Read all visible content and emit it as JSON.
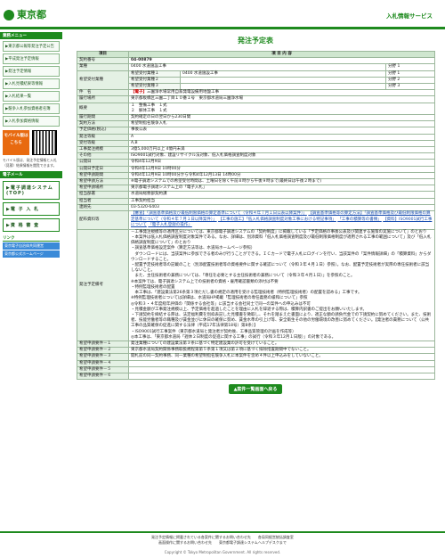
{
  "header": {
    "logo": "東京都",
    "site_name": "入札情報サービス"
  },
  "sidebar": {
    "menu_head": "業務メニュー",
    "items": [
      {
        "label": "▶東京都公報等発注予定公告"
      },
      {
        "label": "▶平成発注予定情報"
      },
      {
        "label": "▶発注予定情報"
      },
      {
        "label": "▶入札見積結果等情報"
      },
      {
        "label": "▶入札結果一覧"
      },
      {
        "label": "▶競争入札参加資格者名簿"
      },
      {
        "label": "▶入札参加資格情報"
      }
    ],
    "mobile_label": "モバイル版はこちら",
    "mobile_note": "モバイル版は、発注予定情報と入札（見積）結果情報を閲覧できます。",
    "big_head": "電子メール",
    "big_buttons": [
      {
        "label": "▶電子調達システム(TOP)"
      },
      {
        "label": "▶電 子 入 札"
      },
      {
        "label": "▶資 格 審 査"
      }
    ],
    "link_head": "リンク",
    "links": [
      {
        "label": "東京電子自治体共同運営"
      },
      {
        "label": "東京都公式ホームページ"
      }
    ]
  },
  "page_title": "発注予定表",
  "table_header": {
    "item": "項目",
    "content": "項 目 内 容"
  },
  "rows": {
    "contract_no": {
      "label": "契約番号",
      "value": "04-00879"
    },
    "business": {
      "label": "業種",
      "value": "0400 水道施設工事",
      "bun_label": "分野",
      "bun": "1"
    },
    "kibo": {
      "label": "希望受付業種",
      "r1": "希望受付業種１",
      "r1v": "0400 水道施設工事",
      "r2": "希望受付業種２",
      "r3": "希望受付業種３",
      "b1": "分野 1",
      "b2": "分野 2",
      "b3": "分野 3"
    },
    "name": {
      "label": "件　名",
      "tag": "【電子】",
      "value": "三園浄水場常用自家発電設備用地盤工事"
    },
    "place": {
      "label": "履行場所",
      "value": "東京都板橋区三園二丁目１０番１号　東京都水道局三園浄水場"
    },
    "outline": {
      "label": "概要",
      "l1": "１　整備工事　１式",
      "l2": "２　解体工事　１式"
    },
    "period": {
      "label": "履行期間",
      "value": "契約確定の日の翌日から230日間"
    },
    "method": {
      "label": "契約方法",
      "value": "希望制指名競争入札"
    },
    "price": {
      "label": "予定価格(税込)",
      "value": "事後公表"
    },
    "dept": {
      "label": "発注等級",
      "value": "A"
    },
    "grade": {
      "label": "受付等級",
      "value": "A,B"
    },
    "scale": {
      "label": "工事発注規模",
      "value": "3億5,000万円以上 4億円未満"
    },
    "other": {
      "label": "その他",
      "value": "ISO9001試行対象、建設リサイクル法対象、低入札価格調査制度対象"
    },
    "announce": {
      "label": "公開日",
      "value": "令和4年12月9日"
    },
    "koukai": {
      "label": "公開日予定日",
      "value": "令和4年12月9日 10時00分"
    },
    "kiboper": {
      "label": "希望申請期間",
      "value": "令和4年12月9日 10時00分から令和4年12月13日 14時00分"
    },
    "howto": {
      "label": "希望申請方法",
      "value": "※電子調達システムでの希望受付時間は、土曜日を除く午前８時から午後９時まで(最終日は午後２時まで)"
    },
    "where": {
      "label": "希望申請場所",
      "value": "東京都電子調達システム上の「電子入札」"
    },
    "office": {
      "label": "担当部署",
      "value": "水道局総務部契約課"
    },
    "person": {
      "label": "担当者",
      "value": "工事契約担当"
    },
    "tel": {
      "label": "連絡先",
      "value": "03-5320-6403"
    },
    "docs": {
      "label": "配布資料等",
      "l1": "【審査】「調査基準価格及び最低制限価格の算定基準について（令和４年７月１日公表以降案件）」",
      "l2": "【調査基準価格等の算定方法】「調査基準価格及び最低制限価格の算定基準について（令和４年７月１日以降案件）」",
      "l3": "【工事の施工】「低入札価格調査制度対象工事における特記事項」",
      "l4": "「工事の積算等の書類」",
      "l5": "【資料】ISO9001試行工事について",
      "l6": "『電子入札登録の操作』"
    },
    "memo": {
      "label": "発注予定備考",
      "lines": [
        "－工事発注規模等の適用区分については、東京都電子調達システムの「契約制度」に掲載している「予定価格の事後公表及び関連する施策の実施について」のとおり",
        "・本案件は低入札価格調査制度対象案件である。なお、詳細は、別添資料「低入札価格調査制度及び最低制限価格制度が適用される工事の範囲について」及び「低入札価格調査制度について」のとおり",
        "・調査基準価格設定案件（算定方法等は、水道局ホームページ参照）",
        "　ダウンロードには、当該案件に参加できる者のみが行うことができる。ＩＣカードで電子入札にログインを行い、当該案件の「案件情報詳細」の「積算資料」からダウンロードすること。",
        "・配置予定技術者等の記載のこと（別添配置技術者等の資格要件に関する確認について（令和３年４月１日）参照）。なお、配置予定技術者が実際の専任技術者に該当しないこと。",
        "　また、主任技術者の兼務については、「専任を必要とする主任技術者の兼務について（令和３年４月１日）」を参照のこと。",
        "※本案件では、電子調達システム上での技術者の資格・雇用確認書類の添付は不要",
        "・特例監理技術者の配置",
        "　本工事は、「建設業法第26条第３項ただし書の規定の適用を受ける監理技術者（特例監理技術者）の配置を認める」工事です。",
        "※特例監理技術者については詳細は、水道局HP掲載「監理技術者の専任義務の緩和について」参照",
        "◎令和３・４年度経年評価の「関係する会社等」に該当する会社同士で同一の案件への申込みは不可",
        "・見積金額が工事発注規模以上、予定価格を超過したことを理由に入札を辞退する際は、積算内訳書のご提出をお願いいたします。",
        "・下請契約を締結する際は、法定福利費を別枠表記した見積書を徴取し、それを踏まえた書面により、適正な額の請負代金での下請契約に努めてください。また、技術者、技能労働者等の職種及び賃金並びに休日の確保に努め、賃金水準の引上げ等、安全衛生その他の労働環境の改善に努めてください。【発注者の責務について（公共工事の品質確保の促進に関する法律（平成17年法律第18号）第8条）】",
        "・ISO9001試行工事案件（東京都水道局と発注者が契約後、工事品質管理の計画を作成等）",
        "◎本工事は、「東京都水道局「週休２日制度の促進に関する工事」の試行（令和３年12月１日版）」の対象である。"
      ]
    },
    "k1": {
      "label": "希望申請要件－１",
      "value": "発注業種についての建設業法第３条に基づく特定建設業の許可を受けていること。"
    },
    "k2": {
      "label": "希望申請要件－２",
      "value": "東京都水道局契約関係事務取扱規程第第５条第１項又は第２項に基づく排除措置期間中でないこと。"
    },
    "k3": {
      "label": "希望申請要件－３",
      "value": "開札前の同一契約事務、同一業種の希望制指名競争入札に本案件を含め４件以上申込みをしていないこと。"
    },
    "k4": {
      "label": "希望申請要件－４",
      "value": ""
    },
    "k5": {
      "label": "希望申請要件－５",
      "value": ""
    },
    "k6": {
      "label": "希望申請要件－６",
      "value": ""
    }
  },
  "back_button": "▲案件一覧画面へ戻る",
  "footer": {
    "l1": "発注予定情報に掲載されている各案件に関するお問い合わせ先　　各局同経営統括調査室",
    "l2": "画面操作に関するお問い合わせ先　　東京都電子調達システムヘルプデスクまで",
    "copy": "Copyright © Tokyo Metropolitan Government. All rights reserved."
  }
}
